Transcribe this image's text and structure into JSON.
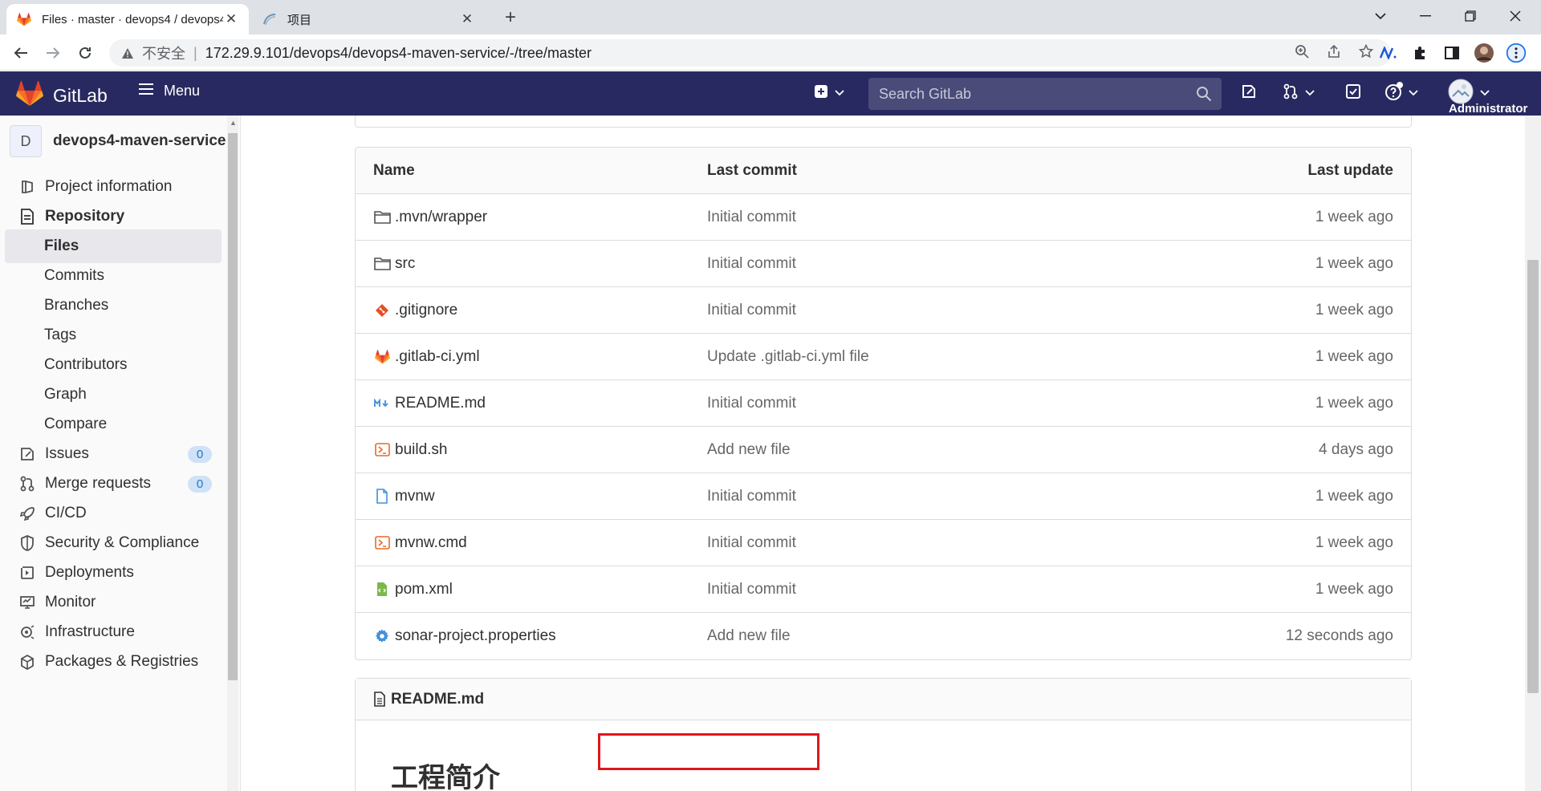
{
  "browser": {
    "active_tab_title": "Files · master · devops4 / devops4-maven-service · GitLab",
    "inactive_tab_title": "项目",
    "insecure_label": "不安全",
    "separator": "|",
    "url": "172.29.9.101/devops4/devops4-maven-service/-/tree/master"
  },
  "header": {
    "brand": "GitLab",
    "menu_label": "Menu",
    "search_placeholder": "Search GitLab",
    "user_label": "Administrator",
    "colors": {
      "bg": "#292961",
      "accent": "#fc6d26"
    }
  },
  "sidebar": {
    "project_initial": "D",
    "project_name": "devops4-maven-service",
    "items": [
      {
        "label": "Project information",
        "icon": "project-info-icon"
      },
      {
        "label": "Repository",
        "icon": "repository-icon"
      },
      {
        "label": "Files"
      },
      {
        "label": "Commits"
      },
      {
        "label": "Branches"
      },
      {
        "label": "Tags"
      },
      {
        "label": "Contributors"
      },
      {
        "label": "Graph"
      },
      {
        "label": "Compare"
      },
      {
        "label": "Issues",
        "icon": "issues-icon",
        "badge": "0"
      },
      {
        "label": "Merge requests",
        "icon": "merge-request-icon",
        "badge": "0"
      },
      {
        "label": "CI/CD",
        "icon": "rocket-icon"
      },
      {
        "label": "Security & Compliance",
        "icon": "shield-icon"
      },
      {
        "label": "Deployments",
        "icon": "deployments-icon"
      },
      {
        "label": "Monitor",
        "icon": "monitor-icon"
      },
      {
        "label": "Infrastructure",
        "icon": "infrastructure-icon"
      },
      {
        "label": "Packages & Registries",
        "icon": "package-icon"
      }
    ]
  },
  "tree": {
    "headers": {
      "name": "Name",
      "commit": "Last commit",
      "update": "Last update"
    },
    "rows": [
      {
        "name": ".mvn/wrapper",
        "icon": "folder-icon",
        "commit": "Initial commit",
        "update": "1 week ago"
      },
      {
        "name": "src",
        "icon": "folder-icon",
        "commit": "Initial commit",
        "update": "1 week ago"
      },
      {
        "name": ".gitignore",
        "icon": "git-icon",
        "commit": "Initial commit",
        "update": "1 week ago"
      },
      {
        "name": ".gitlab-ci.yml",
        "icon": "gitlab-icon",
        "commit": "Update .gitlab-ci.yml file",
        "update": "1 week ago"
      },
      {
        "name": "README.md",
        "icon": "markdown-icon",
        "commit": "Initial commit",
        "update": "1 week ago"
      },
      {
        "name": "build.sh",
        "icon": "terminal-icon",
        "commit": "Add new file",
        "update": "4 days ago"
      },
      {
        "name": "mvnw",
        "icon": "file-icon",
        "commit": "Initial commit",
        "update": "1 week ago"
      },
      {
        "name": "mvnw.cmd",
        "icon": "terminal-icon",
        "commit": "Initial commit",
        "update": "1 week ago"
      },
      {
        "name": "pom.xml",
        "icon": "xml-icon",
        "commit": "Initial commit",
        "update": "1 week ago"
      },
      {
        "name": "sonar-project.properties",
        "icon": "gear-icon",
        "commit": "Add new file",
        "update": "12 seconds ago"
      }
    ]
  },
  "readme": {
    "filename": "README.md",
    "heading": "工程简介"
  }
}
